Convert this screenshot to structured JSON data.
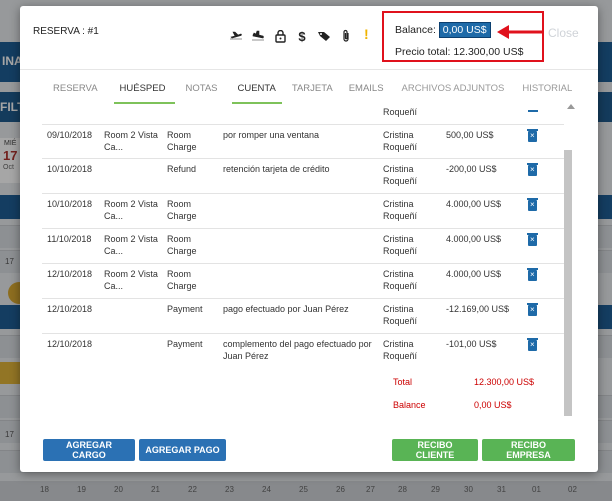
{
  "background": {
    "topbar_text": "INAN",
    "filter_text": "FILTR",
    "cal_dow": "MIÉ",
    "cal_day": "17",
    "cal_month": "Oct",
    "side_num_1": "17",
    "side_num_2": "17",
    "bottom_numbers": [
      "18",
      "19",
      "20",
      "21",
      "22",
      "23",
      "24",
      "25",
      "26",
      "27",
      "28",
      "29",
      "30",
      "31",
      "01",
      "02"
    ]
  },
  "modal": {
    "title": "RESERVA : #1",
    "balance_label": "Balance:",
    "balance_value": "0,00 US$",
    "total_label": "Precio total:",
    "total_value": "12.300,00 US$",
    "close_label": "Close",
    "warning": "!",
    "icons": [
      "plane-departure-icon",
      "plane-arrival-icon",
      "lock-icon",
      "dollar-icon",
      "tag-icon",
      "paperclip-icon"
    ]
  },
  "tabs": [
    {
      "label": "RESERVA"
    },
    {
      "label": "HUÉSPED"
    },
    {
      "label": "NOTAS"
    },
    {
      "label": "CUENTA"
    },
    {
      "label": "TARJETA"
    },
    {
      "label": "EMAILS"
    },
    {
      "label": "ARCHIVOS ADJUNTOS"
    },
    {
      "label": "HISTORIAL"
    }
  ],
  "table": {
    "top_partial_user": "Roqueñí",
    "rows": [
      {
        "date": "09/10/2018",
        "room": "Room 2 Vista Ca...",
        "type": "Room Charge",
        "desc": "por romper una ventana",
        "user": "Cristina Roqueñí",
        "amount": "500,00 US$"
      },
      {
        "date": "10/10/2018",
        "room": "",
        "type": "Refund",
        "desc": "retención tarjeta de crédito",
        "user": "Cristina Roqueñí",
        "amount": "-200,00 US$"
      },
      {
        "date": "10/10/2018",
        "room": "Room 2 Vista Ca...",
        "type": "Room Charge",
        "desc": "",
        "user": "Cristina Roqueñí",
        "amount": "4.000,00 US$"
      },
      {
        "date": "11/10/2018",
        "room": "Room 2 Vista Ca...",
        "type": "Room Charge",
        "desc": "",
        "user": "Cristina Roqueñí",
        "amount": "4.000,00 US$"
      },
      {
        "date": "12/10/2018",
        "room": "Room 2 Vista Ca...",
        "type": "Room Charge",
        "desc": "",
        "user": "Cristina Roqueñí",
        "amount": "4.000,00 US$"
      },
      {
        "date": "12/10/2018",
        "room": "",
        "type": "Payment",
        "desc": "pago efectuado por Juan Pérez",
        "user": "Cristina Roqueñí",
        "amount": "-12.169,00 US$"
      },
      {
        "date": "12/10/2018",
        "room": "",
        "type": "Payment",
        "desc": "complemento del pago efectuado por Juan Pérez",
        "user": "Cristina Roqueñí",
        "amount": "-101,00 US$"
      }
    ],
    "summary": [
      {
        "label": "Total",
        "value": "12.300,00 US$"
      },
      {
        "label": "Balance",
        "value": "0,00 US$"
      }
    ]
  },
  "buttons": {
    "add_charge": "AGREGAR CARGO",
    "add_payment": "AGREGAR PAGO",
    "client_receipt": "RECIBO CLIENTE",
    "company_receipt": "RECIBO EMPRESA"
  },
  "colors": {
    "accent_blue": "#2b71b4",
    "accent_green": "#59b455",
    "highlight_red": "#e0111c",
    "summary_red": "#cc0000"
  }
}
